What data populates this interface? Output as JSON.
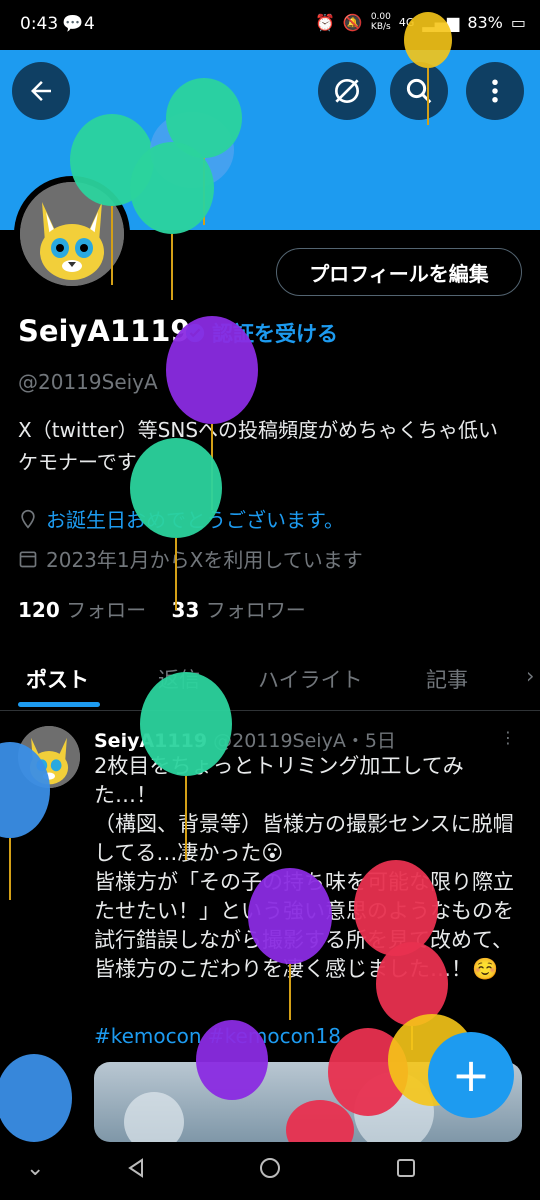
{
  "status": {
    "time": "0:43",
    "notif_count": "4",
    "speed": "0.00",
    "speed_unit": "KB/s",
    "net": "4G",
    "battery": "83%"
  },
  "profile": {
    "name": "SeiyA1119",
    "verify_label": "認証を受ける",
    "handle": "@20119SeiyA",
    "bio": "X（twitter）等SNSへの投稿頻度がめちゃくちゃ低いケモナーです",
    "birthday_text": "お誕生日おめでとうございます。",
    "joined_text": "2023年1月からXを利用しています",
    "following_count": "120",
    "following_label": "フォロー",
    "followers_count": "33",
    "followers_label": "フォロワー",
    "edit_button": "プロフィールを編集"
  },
  "tabs": [
    "ポスト",
    "返信",
    "ハイライト",
    "記事"
  ],
  "post": {
    "author": "SeiyA1119",
    "meta": "@20119SeiyA・5日",
    "text": "2枚目をちょっとトリミング加工してみた…！\n（構図、背景等）皆様方の撮影センスに脱帽してる…凄かった😮\n皆様方が「その子の持ち味を可能な限り際立たせたい！」という強い意思のようなものを試行錯誤しながら撮影する所を見て改めて、皆様方のこだわりを凄く感じました…！☺️",
    "tags": "#kemocon #kemocon18"
  },
  "icons": {
    "back": "arrow-left-icon",
    "repost": "no-retweet-icon",
    "search": "search-icon",
    "more": "more-vertical-icon",
    "location": "location-icon",
    "calendar": "calendar-icon",
    "compose": "plus-icon"
  },
  "colors": {
    "accent": "#1d9bf0",
    "banner": "#1d9bf0",
    "background": "#000000"
  }
}
